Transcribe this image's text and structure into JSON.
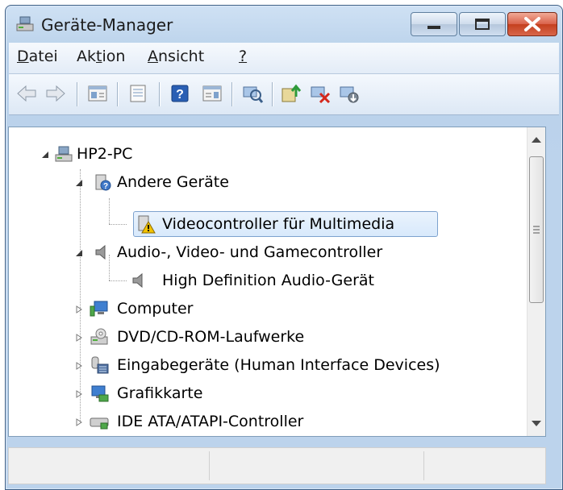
{
  "window": {
    "title": "Geräte-Manager",
    "icon": "computer-management-icon"
  },
  "caption_buttons": [
    "minimize",
    "maximize",
    "close"
  ],
  "menu": [
    {
      "label_rest": "atei",
      "mnemonic": "D"
    },
    {
      "label_pre": "Ak",
      "mnemonic": "t",
      "label_rest": "ion"
    },
    {
      "mnemonic": "A",
      "label_rest": "nsicht"
    },
    {
      "mnemonic": "?"
    }
  ],
  "toolbar": {
    "buttons": [
      "back-icon",
      "forward-icon",
      "show-hide-console-tree-icon",
      "properties-icon",
      "help-icon",
      "show-action-pane-icon",
      "scan-hardware-icon",
      "update-driver-icon",
      "uninstall-icon",
      "disable-device-icon"
    ]
  },
  "tree": {
    "root": "HP2-PC",
    "nodes": [
      {
        "label": "Andere Geräte",
        "icon": "unknown-device-icon"
      },
      {
        "label": "Videocontroller für Multimedia",
        "icon": "warning-device-icon"
      },
      {
        "label": "Audio-, Video- und Gamecontroller",
        "icon": "speaker-icon"
      },
      {
        "label": "High Definition Audio-Gerät",
        "icon": "speaker-icon"
      },
      {
        "label": "Computer",
        "icon": "computer-icon"
      },
      {
        "label": "DVD/CD-ROM-Laufwerke",
        "icon": "dvd-drive-icon"
      },
      {
        "label": "Eingabegeräte (Human Interface Devices)",
        "icon": "hid-icon"
      },
      {
        "label": "Grafikkarte",
        "icon": "display-adapter-icon"
      },
      {
        "label": "IDE ATA/ATAPI-Controller",
        "icon": "ide-controller-icon"
      }
    ]
  },
  "colors": {
    "selection": "#d8e9fb",
    "selection_border": "#7da2ce",
    "close_button": "#c4401e",
    "warning": "#f2c200"
  }
}
